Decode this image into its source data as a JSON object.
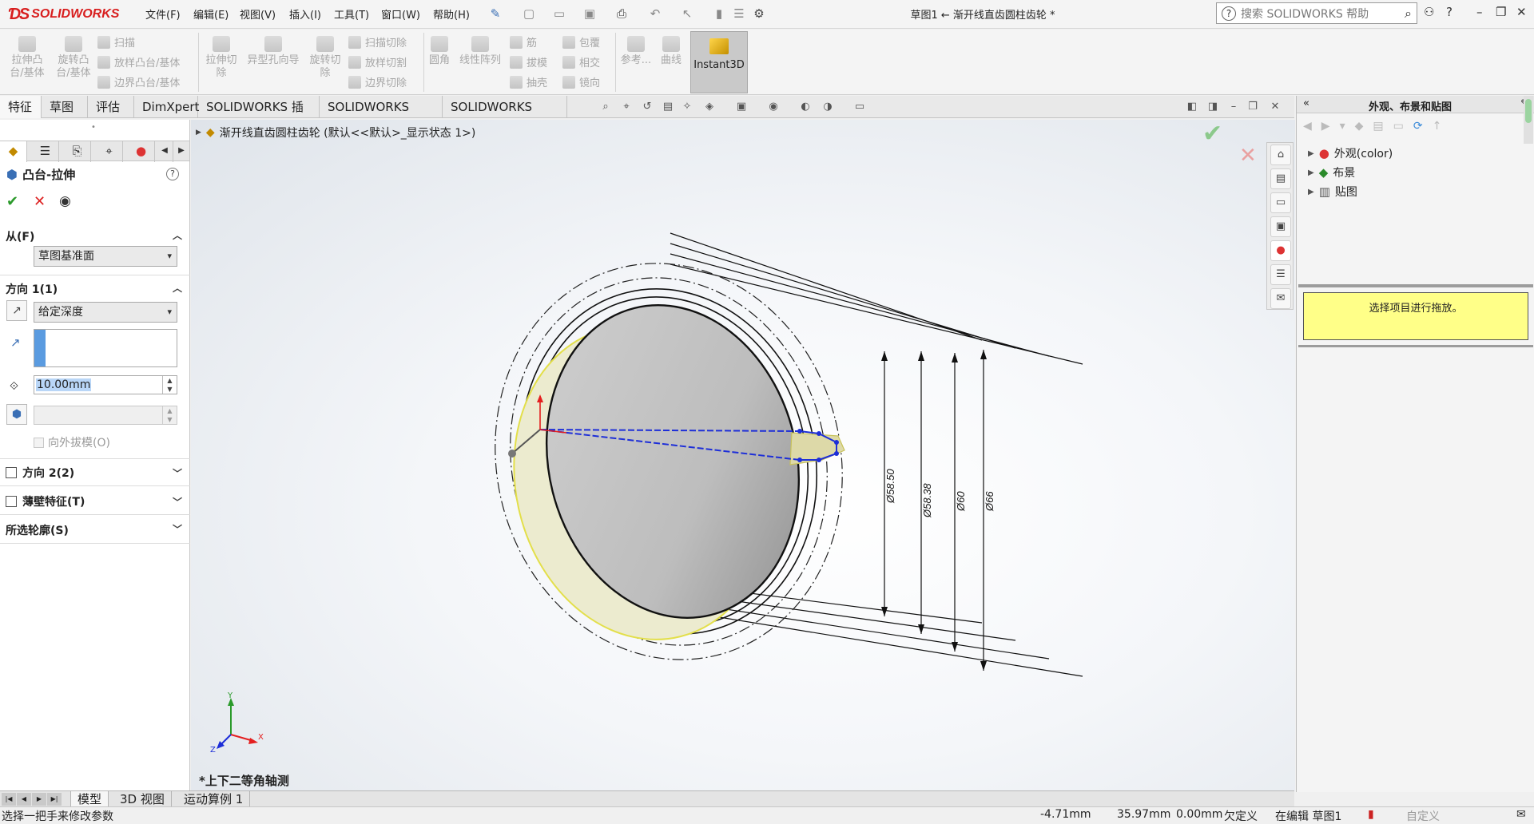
{
  "app": {
    "logo_text": "SOLIDWORKS",
    "document_title": "草图1 ← 渐开线直齿圆柱齿轮 *",
    "menus": [
      "文件(F)",
      "编辑(E)",
      "视图(V)",
      "插入(I)",
      "工具(T)",
      "窗口(W)",
      "帮助(H)"
    ],
    "search_placeholder": "搜索 SOLIDWORKS 帮助",
    "help_symbol": "?"
  },
  "ribbon": {
    "extrude_boss": "拉伸凸\n台/基体",
    "revolve_boss": "旋转凸\n台/基体",
    "sweep": "扫描",
    "loft_boss": "放样凸台/基体",
    "boundary_boss": "边界凸台/基体",
    "extrude_cut": "拉伸切\n除",
    "hole_wizard": "异型孔向导",
    "revolve_cut": "旋转切\n除",
    "swept_cut": "扫描切除",
    "lofted_cut": "放样切割",
    "boundary_cut": "边界切除",
    "fillet": "圆角",
    "linear_pattern": "线性阵列",
    "rib": "筋",
    "draft": "拔模",
    "shell": "抽壳",
    "wrap": "包覆",
    "intersect": "相交",
    "mirror": "镜向",
    "reference": "参考...",
    "curves": "曲线",
    "instant3d": "Instant3D"
  },
  "tabs": [
    "特征",
    "草图",
    "评估",
    "DimXpert",
    "SOLIDWORKS 插件",
    "SOLIDWORKS MBD",
    "SOLIDWORKS CAM"
  ],
  "property_manager": {
    "title": "凸台-拉伸",
    "help": "?",
    "from_label": "从(F)",
    "from_value": "草图基准面",
    "direction1_label": "方向 1(1)",
    "end_condition": "给定深度",
    "depth": "10.00mm",
    "draft_outward": "向外拔模(O)",
    "direction2_label": "方向 2(2)",
    "thin_feature_label": "薄壁特征(T)",
    "selected_contours_label": "所选轮廓(S)"
  },
  "graphics": {
    "tree_path": "渐开线直齿圆柱齿轮 (默认<<默认>_显示状态 1>)",
    "view_name": "*上下二等角轴测",
    "dimensions": [
      "Ø58.50",
      "Ø58.38",
      "Ø60",
      "Ø66"
    ],
    "triad": {
      "x": "X",
      "y": "Y",
      "z": "Z"
    }
  },
  "task_pane": {
    "title": "外观、布景和贴图",
    "items": [
      "外观(color)",
      "布景",
      "贴图"
    ],
    "hint": "选择项目进行拖放。"
  },
  "bottom_tabs": [
    "模型",
    "3D 视图",
    "运动算例 1"
  ],
  "status_bar": {
    "message": "选择一把手来修改参数",
    "x": "-4.71mm",
    "y": "35.97mm",
    "z": "0.00mm",
    "state": "欠定义",
    "editing": "在编辑 草图1",
    "units": "自定义"
  }
}
